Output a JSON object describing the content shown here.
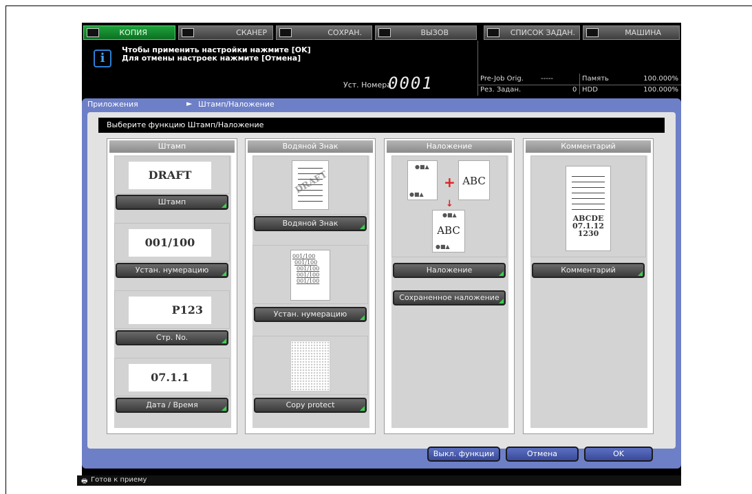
{
  "tabs": [
    {
      "label": "КОПИЯ",
      "icon": "copy-icon",
      "active": true
    },
    {
      "label": "СКАНЕР",
      "icon": "scanner-icon"
    },
    {
      "label": "СОХРАН.",
      "icon": "save-icon"
    },
    {
      "label": "ВЫЗОВ",
      "icon": "recall-icon"
    },
    {
      "label": "СПИСОК ЗАДАН.",
      "icon": "job-list-icon"
    },
    {
      "label": "МАШИНА",
      "icon": "machine-icon"
    }
  ],
  "info": {
    "icon": "i",
    "message_line1": "Чтобы применить настройки нажмите [OK]",
    "message_line2": "Для отмены настроек нажмите [Отмена]",
    "set_no_label": "Уст. Номера",
    "set_no_value": "0001",
    "prejob_label": "Pre-Job Orig.",
    "prejob_value": "-----",
    "memory_label": "Память",
    "memory_value": "100.000%",
    "res_label": "Рез. Задан.",
    "res_value": "0",
    "hdd_label": "HDD",
    "hdd_value": "100.000%"
  },
  "breadcrumb": {
    "item1": "Приложения",
    "arrow": "►",
    "item2": "Штамп/Наложение"
  },
  "panel_title": "Выберите функцию Штамп/Наложение",
  "columns": {
    "stamp": {
      "header": "Штамп",
      "card1": "DRAFT",
      "btn1": "Штамп",
      "card2": "001/100",
      "btn2": "Устан. нумерацию",
      "card3": "P123",
      "btn3": "Стр. No.",
      "card4": "07.1.1",
      "btn4": "Дата / Время"
    },
    "watermark": {
      "header": "Водяной Знак",
      "wm_text": "DRAFT",
      "btn1": "Водяной Знак",
      "num_lines": [
        "001/100",
        "001/100",
        "001/100",
        "001/100",
        "001/100"
      ],
      "btn2": "Устан. нумерацию",
      "btn3": "Copy protect"
    },
    "overlay": {
      "header": "Наложение",
      "abc1": "ABC",
      "abc2": "ABC",
      "plus": "+",
      "arrow": "↓",
      "btn1": "Наложение",
      "btn2": "Сохраненное наложение"
    },
    "comment": {
      "header": "Комментарий",
      "line1": "ABCDE",
      "line2": "07.1.12",
      "line3": "1230",
      "btn1": "Комментарий"
    }
  },
  "bottom": {
    "func_off": "Выкл. функции",
    "cancel": "Отмена",
    "ok": "OK"
  },
  "status": "Готов к приему",
  "colors": {
    "active_tab": "#1fa23c",
    "panel": "#6d7fc7",
    "corner_mark": "#39d24f"
  }
}
